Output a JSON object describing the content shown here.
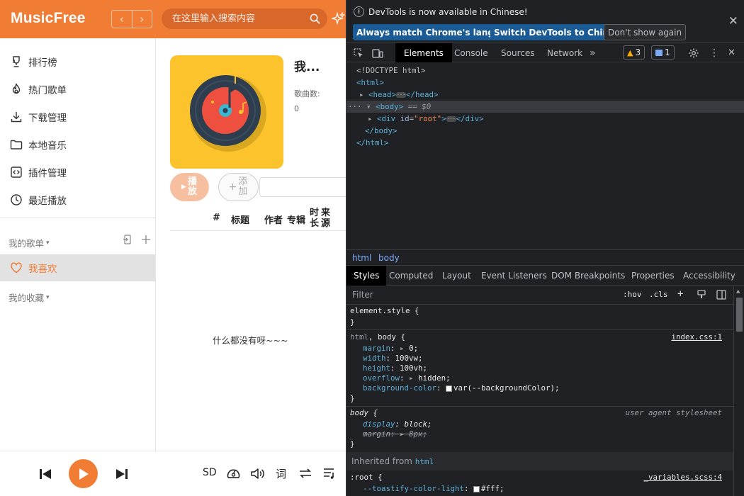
{
  "app": {
    "logo": "MusicFree",
    "search_placeholder": "在这里输入搜索内容",
    "brand_color": "#f17d34",
    "sidebar": {
      "items": [
        {
          "label": "排行榜",
          "icon": "trophy-icon"
        },
        {
          "label": "热门歌单",
          "icon": "fire-icon"
        },
        {
          "label": "下载管理",
          "icon": "download-icon"
        },
        {
          "label": "本地音乐",
          "icon": "folder-icon"
        },
        {
          "label": "插件管理",
          "icon": "plugin-icon"
        },
        {
          "label": "最近播放",
          "icon": "clock-icon"
        }
      ],
      "my_sheets": "我的歌单",
      "favorite": "我喜欢",
      "my_collections": "我的收藏"
    },
    "main": {
      "title": "我...",
      "count_label": "歌曲数:",
      "count_value": "0",
      "play_label": "播放",
      "add_label": "添加",
      "columns": [
        "#",
        "标题",
        "作者",
        "专辑",
        "时长",
        "来源"
      ],
      "empty_text": "什么都没有呀~~~"
    },
    "player": {
      "quality": "SD",
      "lyric": "词"
    }
  },
  "devtools": {
    "infobar": {
      "message": "DevTools is now available in Chinese!",
      "btn_match": "Always match Chrome's language",
      "btn_switch": "Switch DevTools to Chinese",
      "btn_dont_show": "Don't show again"
    },
    "tabs": [
      "Elements",
      "Console",
      "Sources",
      "Network"
    ],
    "warnings": "3",
    "messages": "1",
    "dom": {
      "doctype": "<!DOCTYPE html>",
      "html_open": "<html>",
      "head_open": "<head>",
      "head_close": "</head>",
      "body_open": "<body>",
      "body_suffix": "== $0",
      "div_open": "<div",
      "div_attr_name": "id",
      "div_attr_value": "\"root\"",
      "div_close_bracket": ">",
      "div_close": "</div>",
      "body_close": "</body>",
      "html_close": "</html>"
    },
    "crumbs": [
      "html",
      "body"
    ],
    "subtabs": [
      "Styles",
      "Computed",
      "Layout",
      "Event Listeners",
      "DOM Breakpoints",
      "Properties",
      "Accessibility"
    ],
    "filter_placeholder": "Filter",
    "hov": ":hov",
    "cls": ".cls",
    "styles": {
      "element_style": "element.style {",
      "close_brace": "}",
      "rule1_selector_a": "html",
      "rule1_selector_b": ", body {",
      "rule1_source": "index.css:1",
      "rule1_props": [
        {
          "name": "margin",
          "value": "0;"
        },
        {
          "name": "width",
          "value": "100vw;"
        },
        {
          "name": "height",
          "value": "100vh;"
        },
        {
          "name": "overflow",
          "value": "hidden;"
        },
        {
          "name": "background-color",
          "value": "var(--backgroundColor);"
        }
      ],
      "rule2_selector": "body {",
      "rule2_source": "user agent stylesheet",
      "rule2_props": [
        {
          "name": "display",
          "value": "block;"
        },
        {
          "name": "margin",
          "value": "8px;"
        }
      ],
      "inherited_label": "Inherited from",
      "inherited_tag": "html",
      "root_selector": ":root {",
      "root_source": "_variables.scss:4",
      "root_prop": {
        "name": "--toastify-color-light",
        "value": "#fff;"
      }
    }
  }
}
